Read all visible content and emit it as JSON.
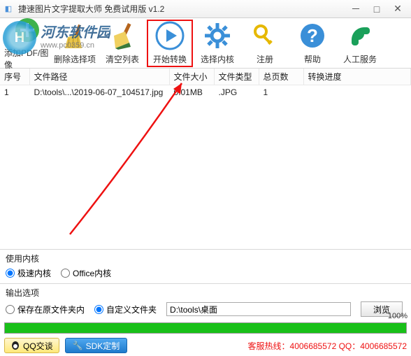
{
  "window": {
    "title": "捷速图片文字提取大师 免费试用版 v1.2"
  },
  "watermark": {
    "line1": "河东软件园",
    "line2": "www.pc0359.cn"
  },
  "toolbar": {
    "add": "添加PDF/图像",
    "remove": "删除选择项",
    "clear": "清空列表",
    "start": "开始转换",
    "core": "选择内核",
    "register": "注册",
    "help": "帮助",
    "service": "人工服务"
  },
  "table": {
    "headers": {
      "seq": "序号",
      "path": "文件路径",
      "size": "文件大小",
      "type": "文件类型",
      "pages": "总页数",
      "progress": "转换进度"
    },
    "rows": [
      {
        "seq": "1",
        "path": "D:\\tools\\...\\2019-06-07_104517.jpg",
        "size": "0.01MB",
        "type": ".JPG",
        "pages": "1",
        "progress": ""
      }
    ]
  },
  "kernel": {
    "title": "使用内核",
    "opt_fast": "极速内核",
    "opt_office": "Office内核"
  },
  "output": {
    "title": "输出选项",
    "opt_same": "保存在原文件夹内",
    "opt_custom": "自定义文件夹",
    "path": "D:\\tools\\桌面",
    "browse": "浏览"
  },
  "progress": {
    "pct": "100%"
  },
  "footer": {
    "qq": "QQ交谈",
    "sdk": "SDK定制",
    "hotline": "客服热线：4006685572 QQ：4006685572"
  }
}
